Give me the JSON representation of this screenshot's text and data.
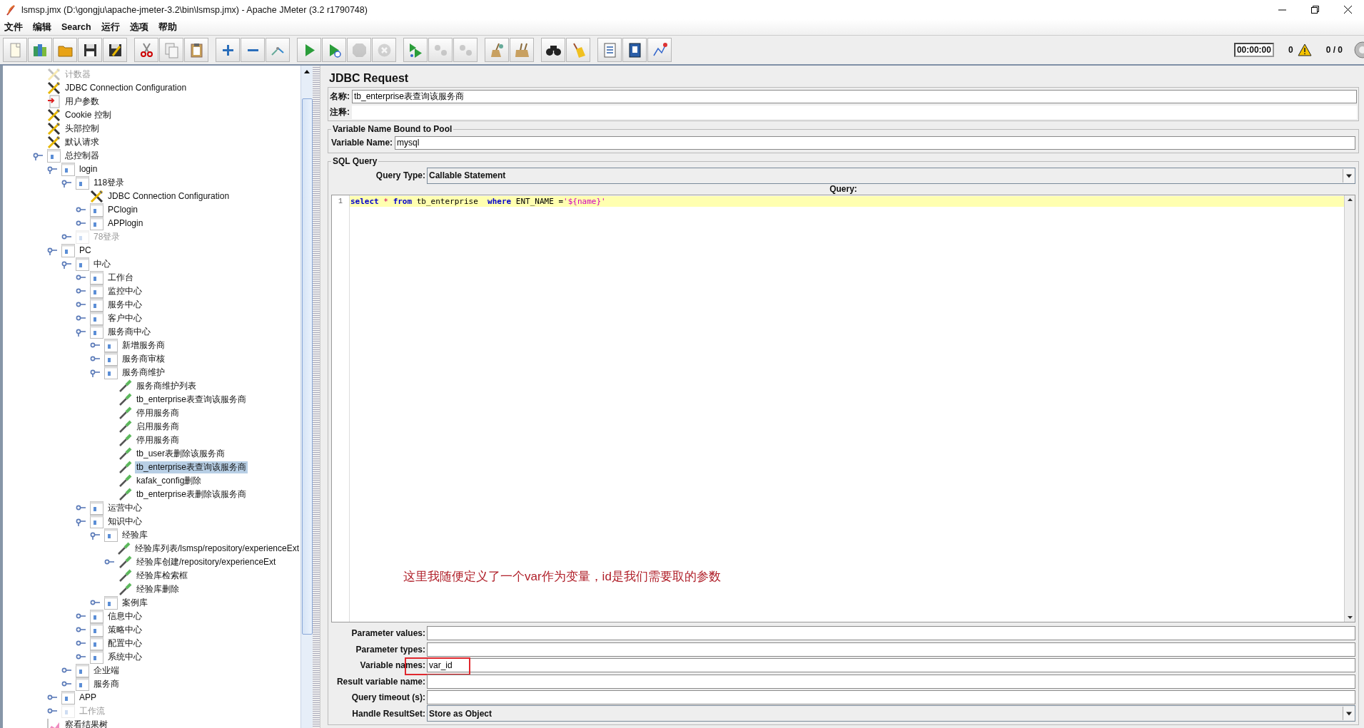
{
  "window": {
    "title": "lsmsp.jmx (D:\\gongju\\apache-jmeter-3.2\\bin\\lsmsp.jmx) - Apache JMeter (3.2 r1790748)"
  },
  "menu": [
    "文件",
    "编辑",
    "Search",
    "运行",
    "选项",
    "帮助"
  ],
  "toolbar": [
    [
      {
        "kind": "new",
        "disabled": false
      },
      {
        "kind": "templates",
        "disabled": false
      },
      {
        "kind": "open",
        "disabled": false
      },
      {
        "kind": "save",
        "disabled": false
      },
      {
        "kind": "save_as",
        "disabled": false
      }
    ],
    [
      {
        "kind": "cut",
        "disabled": false
      },
      {
        "kind": "copy",
        "disabled": false
      },
      {
        "kind": "paste",
        "disabled": false
      }
    ],
    [
      {
        "kind": "expand",
        "disabled": false
      },
      {
        "kind": "collapse",
        "disabled": false
      },
      {
        "kind": "toggle",
        "disabled": false
      }
    ],
    [
      {
        "kind": "start",
        "disabled": false
      },
      {
        "kind": "start_no_pause",
        "disabled": false
      },
      {
        "kind": "stop",
        "disabled": true
      },
      {
        "kind": "shutdown",
        "disabled": true
      }
    ],
    [
      {
        "kind": "remote_start",
        "disabled": false
      },
      {
        "kind": "remote_stop",
        "disabled": true
      },
      {
        "kind": "remote_exit",
        "disabled": true
      }
    ],
    [
      {
        "kind": "clear",
        "disabled": false
      },
      {
        "kind": "clear_all",
        "disabled": false
      }
    ],
    [
      {
        "kind": "search",
        "disabled": false
      },
      {
        "kind": "reset_search",
        "disabled": false
      }
    ],
    [
      {
        "kind": "function_helper",
        "disabled": false
      },
      {
        "kind": "help",
        "disabled": false
      },
      {
        "kind": "logger",
        "disabled": false
      }
    ]
  ],
  "status": {
    "elapsed": "00:00:00",
    "errors": "0",
    "threads": "0 / 0"
  },
  "tree": [
    {
      "label": "计数器",
      "kind": "config",
      "selected": false,
      "disabled": true
    },
    {
      "label": "JDBC Connection Configuration",
      "kind": "config",
      "selected": false,
      "disabled": false
    },
    {
      "label": "用户参数",
      "kind": "params",
      "selected": false,
      "disabled": false
    },
    {
      "label": "Cookie 控制",
      "kind": "config",
      "selected": false,
      "disabled": false
    },
    {
      "label": "头部控制",
      "kind": "config",
      "selected": false,
      "disabled": false
    },
    {
      "label": "默认请求",
      "kind": "config",
      "selected": false,
      "disabled": false
    },
    {
      "label": "总控制器",
      "kind": "controller",
      "selected": false,
      "disabled": false,
      "expanded": true,
      "children": [
        {
          "label": "login",
          "kind": "controller",
          "selected": false,
          "disabled": false,
          "expanded": true,
          "children": [
            {
              "label": "118登录",
              "kind": "controller",
              "selected": false,
              "disabled": false,
              "expanded": true,
              "children": [
                {
                  "label": "JDBC Connection Configuration",
                  "kind": "config",
                  "selected": false,
                  "disabled": false
                },
                {
                  "label": "PClogin",
                  "kind": "controller",
                  "selected": false,
                  "disabled": false,
                  "expanded": false
                },
                {
                  "label": "APPlogin",
                  "kind": "controller",
                  "selected": false,
                  "disabled": false,
                  "expanded": false
                }
              ]
            },
            {
              "label": "78登录",
              "kind": "controller",
              "selected": false,
              "disabled": true,
              "expanded": false
            }
          ]
        },
        {
          "label": "PC",
          "kind": "controller",
          "selected": false,
          "disabled": false,
          "expanded": true,
          "children": [
            {
              "label": "中心",
              "kind": "controller",
              "selected": false,
              "disabled": false,
              "expanded": true,
              "children": [
                {
                  "label": "工作台",
                  "kind": "controller",
                  "selected": false,
                  "disabled": false,
                  "expanded": false
                },
                {
                  "label": "监控中心",
                  "kind": "controller",
                  "selected": false,
                  "disabled": false,
                  "expanded": false
                },
                {
                  "label": "服务中心",
                  "kind": "controller",
                  "selected": false,
                  "disabled": false,
                  "expanded": false
                },
                {
                  "label": "客户中心",
                  "kind": "controller",
                  "selected": false,
                  "disabled": false,
                  "expanded": false
                },
                {
                  "label": "服务商中心",
                  "kind": "controller",
                  "selected": false,
                  "disabled": false,
                  "expanded": true,
                  "children": [
                    {
                      "label": "新增服务商",
                      "kind": "controller",
                      "selected": false,
                      "disabled": false,
                      "expanded": false
                    },
                    {
                      "label": "服务商审核",
                      "kind": "controller",
                      "selected": false,
                      "disabled": false,
                      "expanded": false
                    },
                    {
                      "label": "服务商维护",
                      "kind": "controller",
                      "selected": false,
                      "disabled": false,
                      "expanded": true,
                      "children": [
                        {
                          "label": "服务商维护列表",
                          "kind": "sampler",
                          "selected": false,
                          "disabled": false
                        },
                        {
                          "label": "tb_enterprise表查询该服务商",
                          "kind": "sampler",
                          "selected": false,
                          "disabled": false
                        },
                        {
                          "label": "停用服务商",
                          "kind": "sampler",
                          "selected": false,
                          "disabled": false
                        },
                        {
                          "label": "启用服务商",
                          "kind": "sampler",
                          "selected": false,
                          "disabled": false
                        },
                        {
                          "label": "停用服务商",
                          "kind": "sampler",
                          "selected": false,
                          "disabled": false
                        },
                        {
                          "label": "tb_user表删除该服务商",
                          "kind": "sampler",
                          "selected": false,
                          "disabled": false
                        },
                        {
                          "label": "tb_enterprise表查询该服务商",
                          "kind": "sampler",
                          "selected": true,
                          "disabled": false
                        },
                        {
                          "label": "kafak_config删除",
                          "kind": "sampler",
                          "selected": false,
                          "disabled": false
                        },
                        {
                          "label": "tb_enterprise表删除该服务商",
                          "kind": "sampler",
                          "selected": false,
                          "disabled": false
                        }
                      ]
                    }
                  ]
                },
                {
                  "label": "运营中心",
                  "kind": "controller",
                  "selected": false,
                  "disabled": false,
                  "expanded": false
                },
                {
                  "label": "知识中心",
                  "kind": "controller",
                  "selected": false,
                  "disabled": false,
                  "expanded": true,
                  "children": [
                    {
                      "label": "经验库",
                      "kind": "controller",
                      "selected": false,
                      "disabled": false,
                      "expanded": true,
                      "children": [
                        {
                          "label": "经验库列表/lsmsp/repository/experienceExt",
                          "kind": "sampler",
                          "selected": false,
                          "disabled": false
                        },
                        {
                          "label": "经验库创建/repository/experienceExt",
                          "kind": "sampler",
                          "selected": false,
                          "disabled": false,
                          "expanded": false
                        },
                        {
                          "label": "经验库检索框",
                          "kind": "sampler",
                          "selected": false,
                          "disabled": false
                        },
                        {
                          "label": "经验库删除",
                          "kind": "sampler",
                          "selected": false,
                          "disabled": false
                        }
                      ]
                    },
                    {
                      "label": "案例库",
                      "kind": "controller",
                      "selected": false,
                      "disabled": false,
                      "expanded": false
                    }
                  ]
                },
                {
                  "label": "信息中心",
                  "kind": "controller",
                  "selected": false,
                  "disabled": false,
                  "expanded": false
                },
                {
                  "label": "策略中心",
                  "kind": "controller",
                  "selected": false,
                  "disabled": false,
                  "expanded": false
                },
                {
                  "label": "配置中心",
                  "kind": "controller",
                  "selected": false,
                  "disabled": false,
                  "expanded": false
                },
                {
                  "label": "系统中心",
                  "kind": "controller",
                  "selected": false,
                  "disabled": false,
                  "expanded": false
                }
              ]
            },
            {
              "label": "企业端",
              "kind": "controller",
              "selected": false,
              "disabled": false,
              "expanded": false
            },
            {
              "label": "服务商",
              "kind": "controller",
              "selected": false,
              "disabled": false,
              "expanded": false
            }
          ]
        },
        {
          "label": "APP",
          "kind": "controller",
          "selected": false,
          "disabled": false,
          "expanded": false
        },
        {
          "label": "工作流",
          "kind": "controller",
          "selected": false,
          "disabled": true,
          "expanded": false
        }
      ]
    },
    {
      "label": "察看结果树",
      "kind": "listener",
      "selected": false,
      "disabled": false
    }
  ],
  "editor": {
    "title": "JDBC Request",
    "name": {
      "label": "名称:",
      "value": "tb_enterprise表查询该服务商"
    },
    "comments": {
      "label": "注释:"
    },
    "pool": {
      "legend": "Variable Name Bound to Pool",
      "label": "Variable Name:",
      "value": "mysql"
    },
    "sql": {
      "legend": "SQL Query",
      "query_type": {
        "label": "Query Type:",
        "value": "Callable Statement"
      },
      "query_label": "Query:",
      "line_number": "1",
      "tokens": [
        {
          "text": "select",
          "kind": "keyword"
        },
        {
          "text": " * ",
          "kind": "operator"
        },
        {
          "text": "from",
          "kind": "keyword"
        },
        {
          "text": " tb_enterprise  ",
          "kind": "plain"
        },
        {
          "text": "where",
          "kind": "keyword"
        },
        {
          "text": " ENT_NAME =",
          "kind": "plain"
        },
        {
          "text": "'${name}'",
          "kind": "string"
        }
      ]
    },
    "fields": [
      {
        "label": "Parameter values:",
        "kind": "text",
        "annotated": false
      },
      {
        "label": "Parameter types:",
        "kind": "text",
        "annotated": false
      },
      {
        "label": "Variable names:",
        "kind": "text",
        "value": "var_id",
        "annotated": true
      },
      {
        "label": "Result variable name:",
        "kind": "text",
        "annotated": false
      },
      {
        "label": "Query timeout (s):",
        "kind": "text",
        "annotated": false
      },
      {
        "label": "Handle ResultSet:",
        "kind": "dropdown",
        "value": "Store as Object",
        "annotated": false
      }
    ]
  },
  "annotation": {
    "text": "这里我随便定义了一个var作为变量，id是我们需要取的参数"
  }
}
